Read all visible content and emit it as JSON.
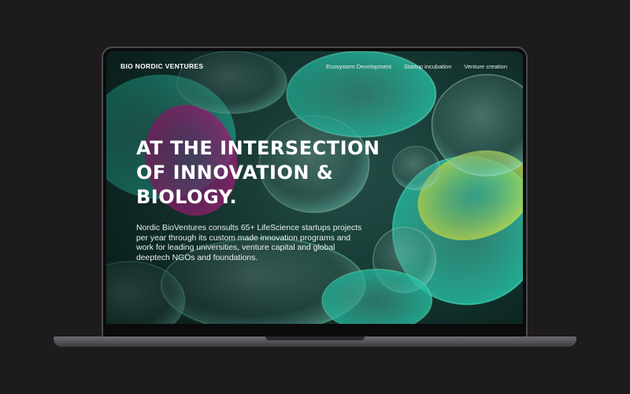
{
  "header": {
    "brand": "BIO NORDIC VENTURES",
    "nav": [
      {
        "label": "Ecosystem Development"
      },
      {
        "label": "Startup incubation"
      },
      {
        "label": "Venture creation"
      }
    ]
  },
  "hero": {
    "title_lines": [
      "AT THE INTERSECTION",
      "OF INNOVATION &",
      "BIOLOGY."
    ],
    "description": "Nordic BioVentures consults 65+ LifeScience startups projects per year through its custom made innovation programs and work for leading universities, venture capital and global deeptech NGOs and foundations."
  },
  "colors": {
    "page_background": "#1e1b1d",
    "screen_base": "#12302c",
    "cell_teal": "#3fbfa8",
    "cell_magenta": "#d8249a",
    "cell_lime": "#b7d84a",
    "text": "#ffffff"
  }
}
